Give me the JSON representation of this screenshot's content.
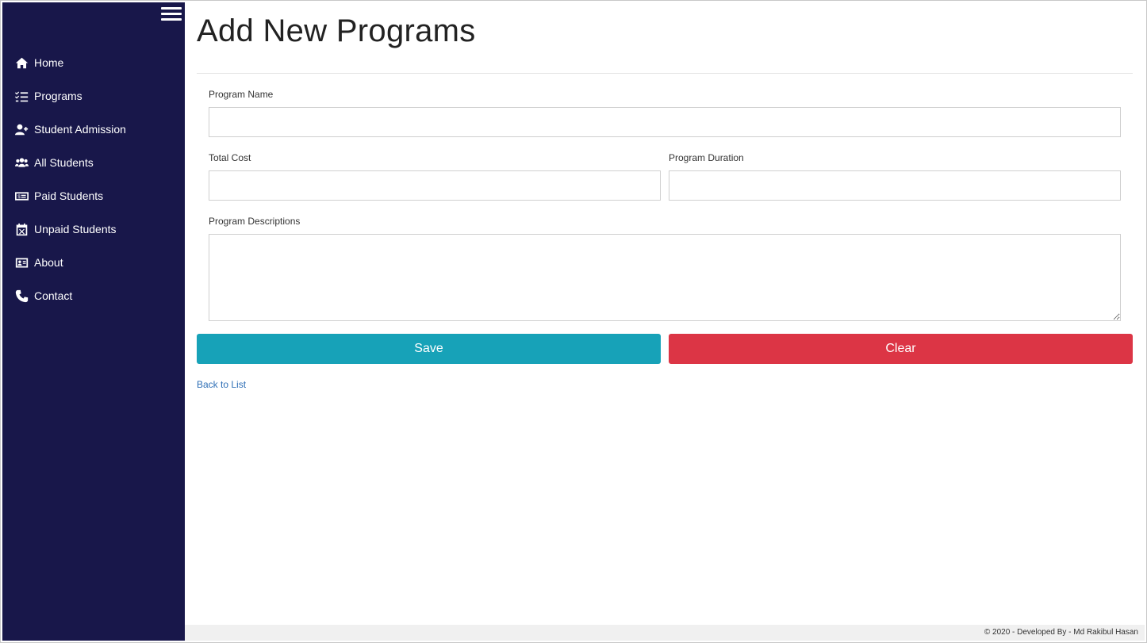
{
  "sidebar": {
    "items": [
      {
        "label": "Home",
        "icon": "home-icon"
      },
      {
        "label": "Programs",
        "icon": "list-check-icon"
      },
      {
        "label": "Student Admission",
        "icon": "user-plus-icon"
      },
      {
        "label": "All Students",
        "icon": "users-icon"
      },
      {
        "label": "Paid Students",
        "icon": "money-bill-icon"
      },
      {
        "label": "Unpaid Students",
        "icon": "calendar-x-icon"
      },
      {
        "label": "About",
        "icon": "id-card-icon"
      },
      {
        "label": "Contact",
        "icon": "phone-icon"
      }
    ]
  },
  "main": {
    "title": "Add New Programs",
    "form": {
      "program_name_label": "Program Name",
      "program_name_value": "",
      "total_cost_label": "Total Cost",
      "total_cost_value": "",
      "program_duration_label": "Program Duration",
      "program_duration_value": "",
      "program_descriptions_label": "Program Descriptions",
      "program_descriptions_value": ""
    },
    "save_label": "Save",
    "clear_label": "Clear",
    "back_link": "Back to List"
  },
  "footer": {
    "text": "© 2020 - Developed By - Md Rakibul Hasan"
  },
  "colors": {
    "sidebar_bg": "#18174a",
    "save_button": "#17a2b8",
    "clear_button": "#dc3545",
    "link": "#2f6fb6"
  }
}
